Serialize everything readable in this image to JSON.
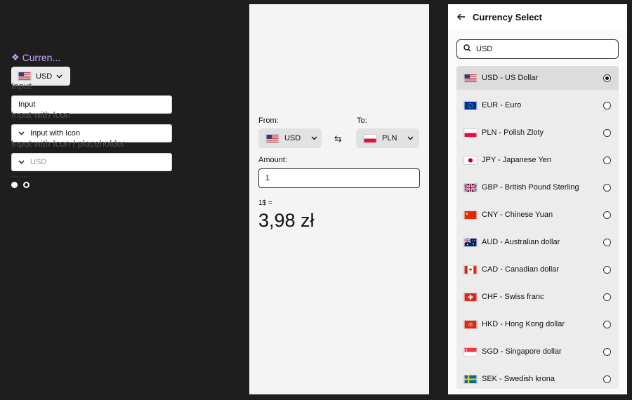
{
  "left": {
    "component_title": "Curren...",
    "mini_select_value": "USD",
    "labels": [
      "Input",
      "Input with Icon",
      "Input with Icon / placeholder"
    ],
    "input_value": "Input",
    "input_icon_value": "Input with Icon",
    "input_placeholder_value": "USD",
    "dots": "... ..."
  },
  "converter": {
    "from_label": "From:",
    "to_label": "To:",
    "from_value": "USD",
    "to_value": "PLN",
    "amount_label": "Amount:",
    "amount_value": "1",
    "rate_prefix": "1$ =",
    "rate_result": "3,98 zł"
  },
  "currency_select": {
    "title": "Currency Select",
    "search_value": "USD",
    "items": [
      {
        "label": "USD - US Dollar",
        "flag": "us",
        "selected": true
      },
      {
        "label": "EUR - Euro",
        "flag": "eu",
        "selected": false
      },
      {
        "label": "PLN - Polish Zloty",
        "flag": "pl",
        "selected": false
      },
      {
        "label": "JPY - Japanese Yen",
        "flag": "jp",
        "selected": false
      },
      {
        "label": "GBP - British Pound Sterling",
        "flag": "gb",
        "selected": false
      },
      {
        "label": "CNY -  Chinese Yuan",
        "flag": "cn",
        "selected": false
      },
      {
        "label": "AUD - Australian dollar",
        "flag": "au",
        "selected": false
      },
      {
        "label": "CAD -  Canadian dollar",
        "flag": "ca",
        "selected": false
      },
      {
        "label": "CHF - Swiss franc",
        "flag": "ch",
        "selected": false
      },
      {
        "label": "HKD - Hong Kong dollar",
        "flag": "hk",
        "selected": false
      },
      {
        "label": "SGD - Singapore dollar",
        "flag": "sg",
        "selected": false
      },
      {
        "label": "SEK - Swedish krona",
        "flag": "se",
        "selected": false
      }
    ]
  },
  "icons": [
    "back-arrow-icon",
    "search-icon",
    "chevron-down-icon",
    "swap-icon",
    "component-diamond-icon"
  ]
}
